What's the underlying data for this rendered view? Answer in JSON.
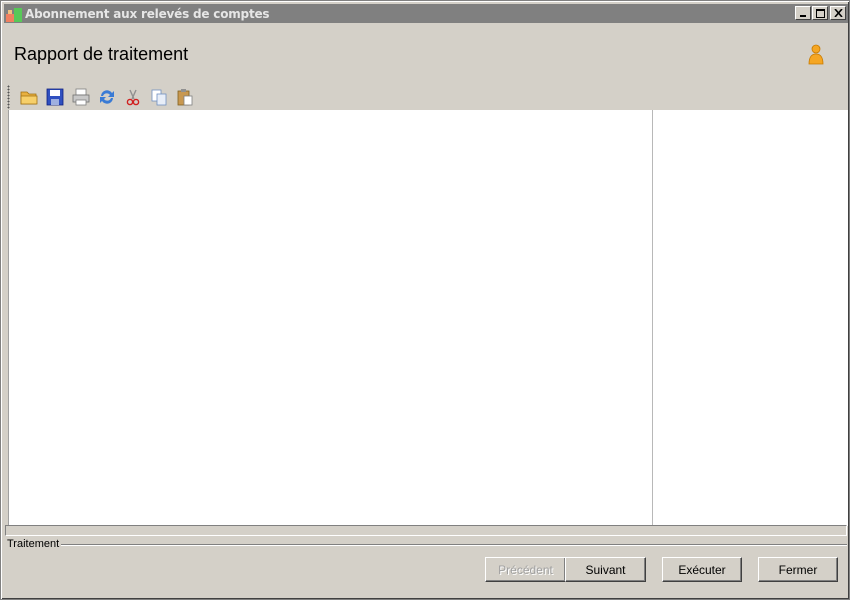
{
  "window": {
    "title": "Abonnement aux relevés de comptes",
    "controls": {
      "minimize": "_",
      "maximize": "□",
      "close": "✕"
    }
  },
  "header": {
    "title": "Rapport de traitement",
    "icon": "user-icon"
  },
  "toolbar": {
    "items": [
      {
        "name": "open",
        "icon": "folder-open-icon"
      },
      {
        "name": "save",
        "icon": "floppy-disk-icon"
      },
      {
        "name": "print",
        "icon": "printer-icon"
      },
      {
        "name": "refresh",
        "icon": "refresh-icon"
      },
      {
        "name": "cut",
        "icon": "scissors-icon"
      },
      {
        "name": "copy",
        "icon": "copy-icon"
      },
      {
        "name": "paste",
        "icon": "paste-icon"
      }
    ]
  },
  "footer": {
    "group_label": "Traitement",
    "buttons": {
      "previous": "Précédent",
      "next": "Suivant",
      "execute": "Exécuter",
      "close": "Fermer"
    },
    "previous_disabled": true
  },
  "colors": {
    "window_bg": "#d4d0c8",
    "titlebar_bg": "#808080",
    "content_bg": "#ffffff"
  }
}
